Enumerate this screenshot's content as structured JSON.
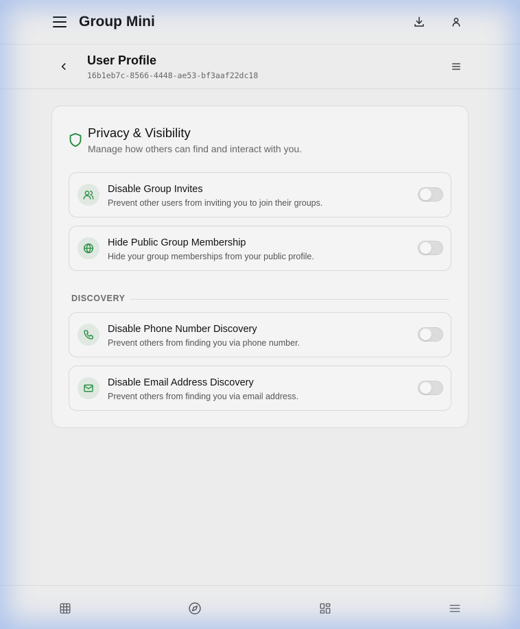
{
  "app": {
    "title": "Group Mini"
  },
  "header": {
    "title": "User Profile",
    "id": "16b1eb7c-8566-4448-ae53-bf3aaf22dc18"
  },
  "card": {
    "title": "Privacy & Visibility",
    "subtitle": "Manage how others can find and interact with you.",
    "icon": "shield-icon",
    "accent": "#1f8a3a",
    "items": [
      {
        "title": "Disable Group Invites",
        "desc": "Prevent other users from inviting you to join their groups.",
        "icon": "users-icon",
        "enabled": false
      },
      {
        "title": "Hide Public Group Membership",
        "desc": "Hide your group memberships from your public profile.",
        "icon": "globe-icon",
        "enabled": false
      }
    ],
    "section": "DISCOVERY",
    "discovery_items": [
      {
        "title": "Disable Phone Number Discovery",
        "desc": "Prevent others from finding you via phone number.",
        "icon": "phone-icon",
        "enabled": false
      },
      {
        "title": "Disable Email Address Discovery",
        "desc": "Prevent others from finding you via email address.",
        "icon": "mail-icon",
        "enabled": false
      }
    ]
  },
  "bottom_nav": [
    "grid-icon",
    "compass-icon",
    "dashboard-icon",
    "menu-icon"
  ]
}
